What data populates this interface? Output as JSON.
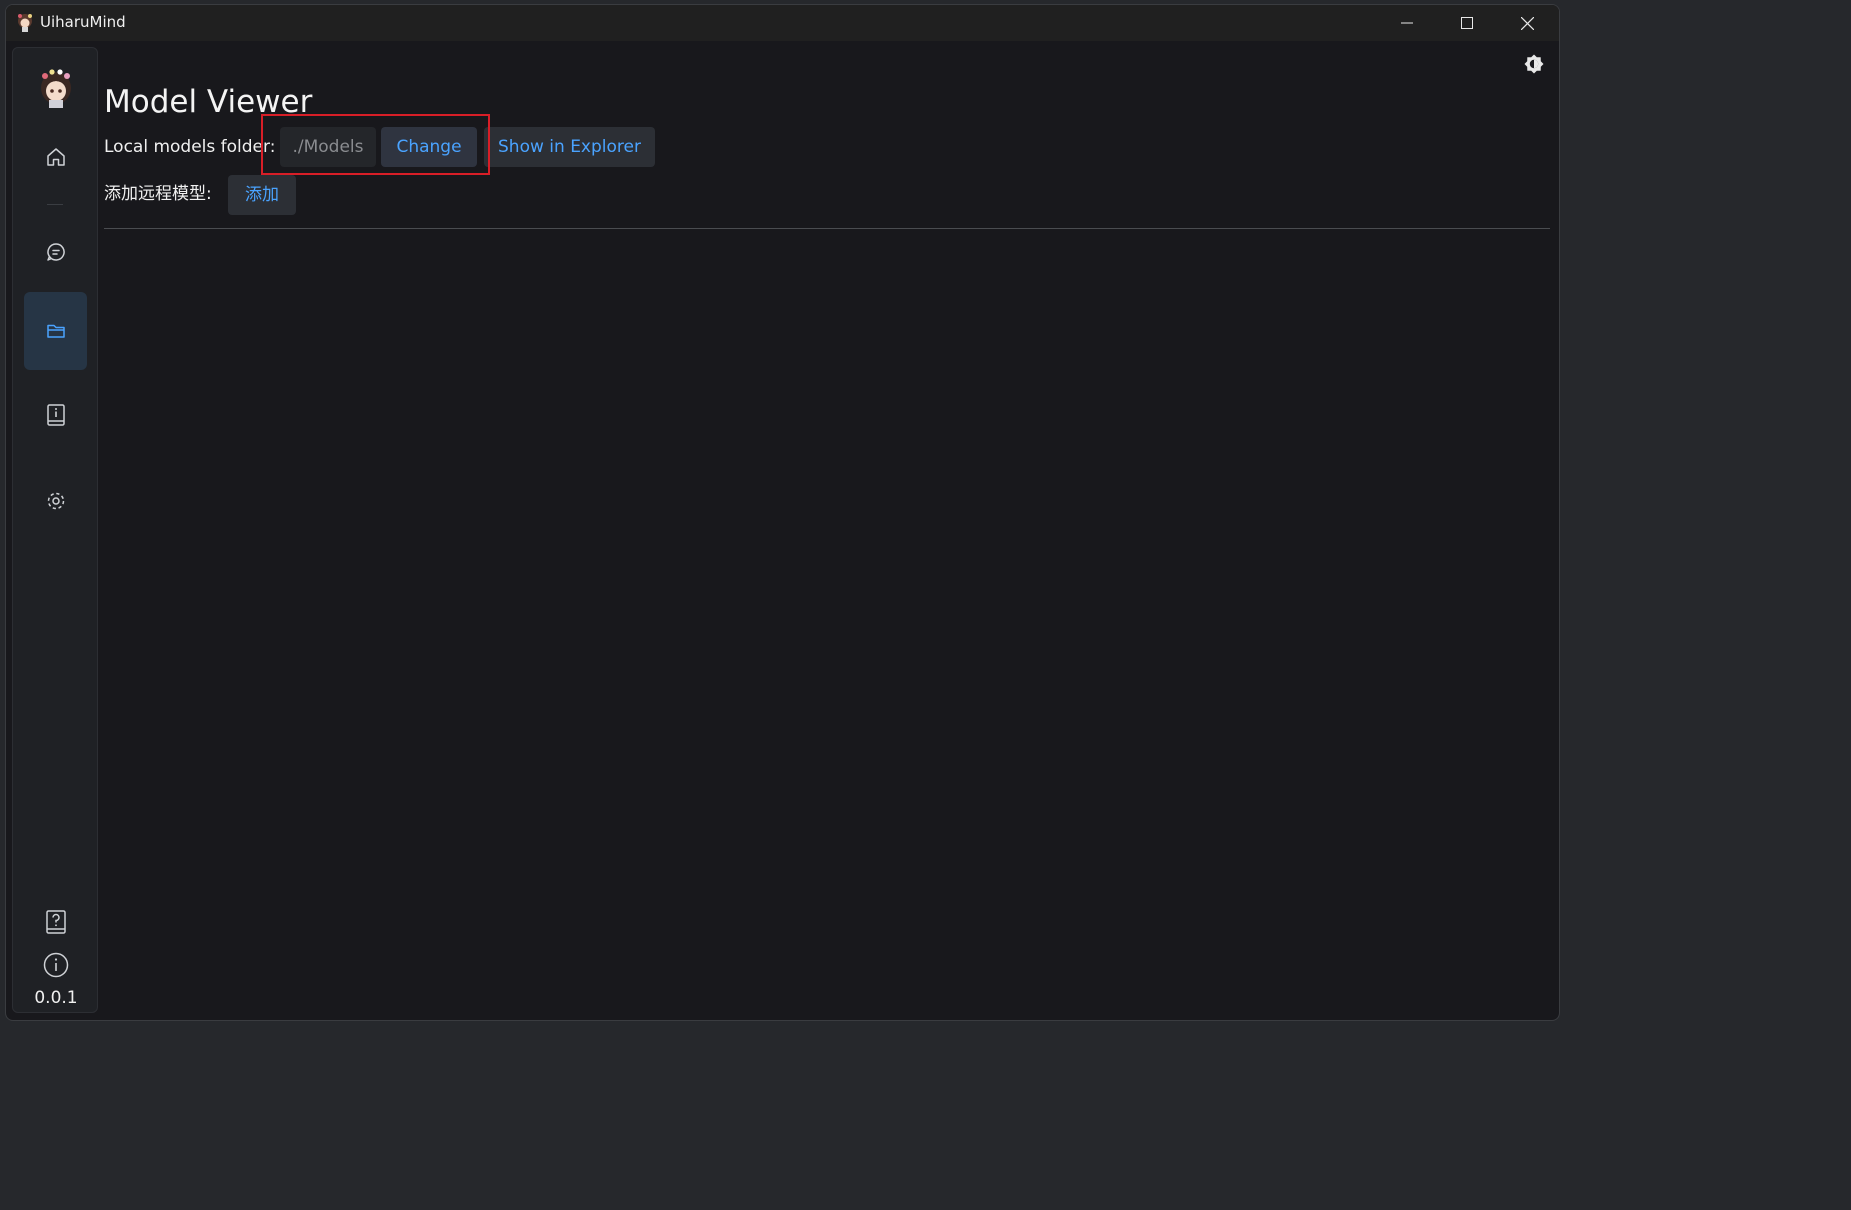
{
  "window": {
    "title": "UiharuMind"
  },
  "sidebar": {
    "items": [
      {
        "name": "home",
        "icon": "home-icon"
      },
      {
        "name": "chat",
        "icon": "chat-icon"
      },
      {
        "name": "models",
        "icon": "folder-icon",
        "active": true
      },
      {
        "name": "docs",
        "icon": "info-book-icon"
      },
      {
        "name": "settings",
        "icon": "gear-icon"
      }
    ],
    "version": "0.0.1"
  },
  "main": {
    "title": "Model Viewer",
    "local_label": "Local models folder:",
    "local_path": "./Models",
    "change_label": "Change",
    "explorer_label": "Show in Explorer",
    "remote_label": "添加远程模型:",
    "add_label": "添加"
  },
  "colors": {
    "accent": "#4aa3ff",
    "active_nav": "#263545",
    "highlight": "#d81e27",
    "background": "#18181c"
  }
}
